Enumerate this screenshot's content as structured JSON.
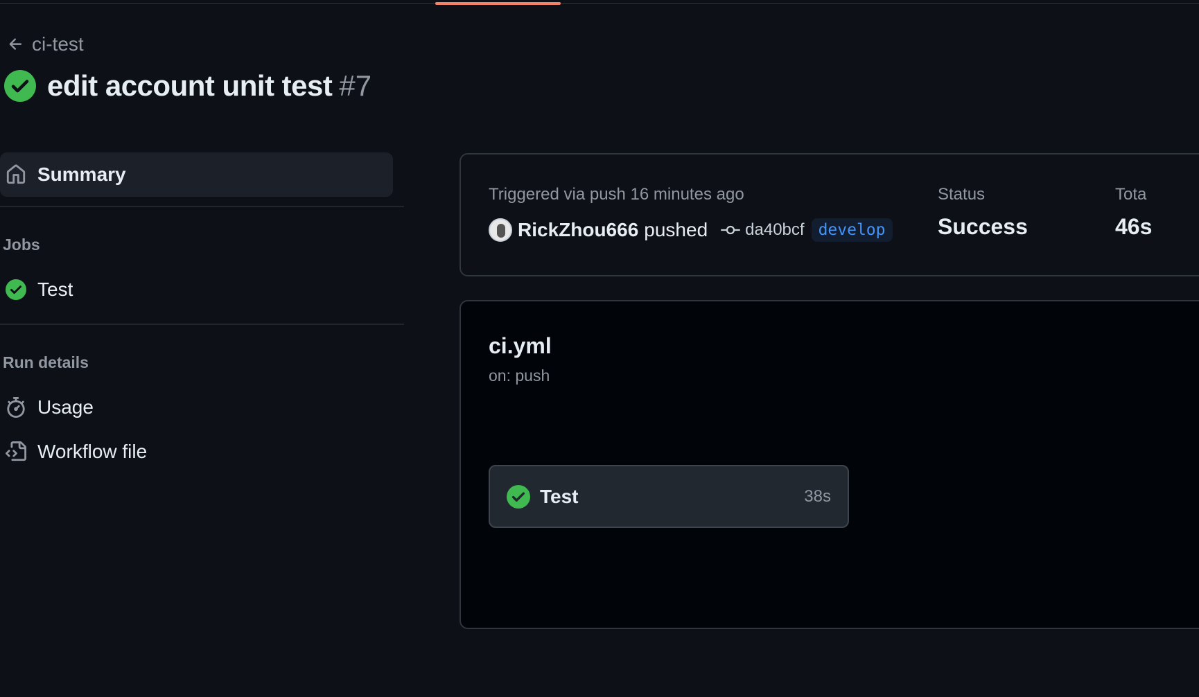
{
  "header": {
    "back_label": "ci-test",
    "run_title": "edit account unit test",
    "run_number": "#7"
  },
  "sidebar": {
    "summary_label": "Summary",
    "jobs_heading": "Jobs",
    "jobs": [
      {
        "label": "Test",
        "status": "success"
      }
    ],
    "run_details_heading": "Run details",
    "details": [
      {
        "label": "Usage",
        "icon": "stopwatch-icon"
      },
      {
        "label": "Workflow file",
        "icon": "file-code-icon"
      }
    ]
  },
  "summary": {
    "trigger_text": "Triggered via push 16 minutes ago",
    "actor": "RickZhou666",
    "action": "pushed",
    "commit_sha": "da40bcf",
    "branch": "develop",
    "status_label": "Status",
    "status_value": "Success",
    "total_label": "Tota",
    "total_value": "46s"
  },
  "workflow": {
    "file_name": "ci.yml",
    "trigger": "on: push",
    "job": {
      "name": "Test",
      "duration": "38s",
      "status": "success"
    }
  },
  "colors": {
    "background": "#0d1117",
    "success": "#3fb950",
    "accent_tab": "#f78166",
    "branch_text": "#4493f8"
  }
}
